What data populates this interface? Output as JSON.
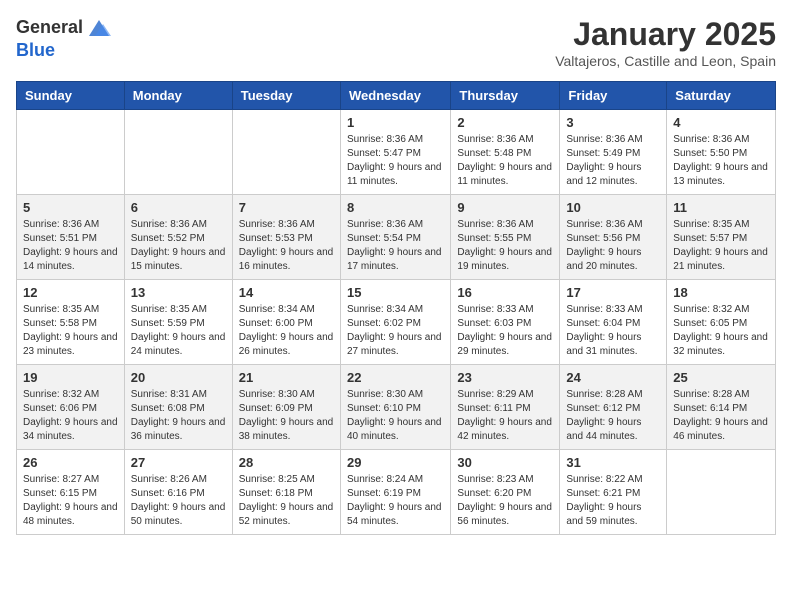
{
  "logo": {
    "general": "General",
    "blue": "Blue"
  },
  "title": "January 2025",
  "subtitle": "Valtajeros, Castille and Leon, Spain",
  "weekdays": [
    "Sunday",
    "Monday",
    "Tuesday",
    "Wednesday",
    "Thursday",
    "Friday",
    "Saturday"
  ],
  "weeks": [
    [
      {
        "day": "",
        "info": ""
      },
      {
        "day": "",
        "info": ""
      },
      {
        "day": "",
        "info": ""
      },
      {
        "day": "1",
        "info": "Sunrise: 8:36 AM\nSunset: 5:47 PM\nDaylight: 9 hours and 11 minutes."
      },
      {
        "day": "2",
        "info": "Sunrise: 8:36 AM\nSunset: 5:48 PM\nDaylight: 9 hours and 11 minutes."
      },
      {
        "day": "3",
        "info": "Sunrise: 8:36 AM\nSunset: 5:49 PM\nDaylight: 9 hours and 12 minutes."
      },
      {
        "day": "4",
        "info": "Sunrise: 8:36 AM\nSunset: 5:50 PM\nDaylight: 9 hours and 13 minutes."
      }
    ],
    [
      {
        "day": "5",
        "info": "Sunrise: 8:36 AM\nSunset: 5:51 PM\nDaylight: 9 hours and 14 minutes."
      },
      {
        "day": "6",
        "info": "Sunrise: 8:36 AM\nSunset: 5:52 PM\nDaylight: 9 hours and 15 minutes."
      },
      {
        "day": "7",
        "info": "Sunrise: 8:36 AM\nSunset: 5:53 PM\nDaylight: 9 hours and 16 minutes."
      },
      {
        "day": "8",
        "info": "Sunrise: 8:36 AM\nSunset: 5:54 PM\nDaylight: 9 hours and 17 minutes."
      },
      {
        "day": "9",
        "info": "Sunrise: 8:36 AM\nSunset: 5:55 PM\nDaylight: 9 hours and 19 minutes."
      },
      {
        "day": "10",
        "info": "Sunrise: 8:36 AM\nSunset: 5:56 PM\nDaylight: 9 hours and 20 minutes."
      },
      {
        "day": "11",
        "info": "Sunrise: 8:35 AM\nSunset: 5:57 PM\nDaylight: 9 hours and 21 minutes."
      }
    ],
    [
      {
        "day": "12",
        "info": "Sunrise: 8:35 AM\nSunset: 5:58 PM\nDaylight: 9 hours and 23 minutes."
      },
      {
        "day": "13",
        "info": "Sunrise: 8:35 AM\nSunset: 5:59 PM\nDaylight: 9 hours and 24 minutes."
      },
      {
        "day": "14",
        "info": "Sunrise: 8:34 AM\nSunset: 6:00 PM\nDaylight: 9 hours and 26 minutes."
      },
      {
        "day": "15",
        "info": "Sunrise: 8:34 AM\nSunset: 6:02 PM\nDaylight: 9 hours and 27 minutes."
      },
      {
        "day": "16",
        "info": "Sunrise: 8:33 AM\nSunset: 6:03 PM\nDaylight: 9 hours and 29 minutes."
      },
      {
        "day": "17",
        "info": "Sunrise: 8:33 AM\nSunset: 6:04 PM\nDaylight: 9 hours and 31 minutes."
      },
      {
        "day": "18",
        "info": "Sunrise: 8:32 AM\nSunset: 6:05 PM\nDaylight: 9 hours and 32 minutes."
      }
    ],
    [
      {
        "day": "19",
        "info": "Sunrise: 8:32 AM\nSunset: 6:06 PM\nDaylight: 9 hours and 34 minutes."
      },
      {
        "day": "20",
        "info": "Sunrise: 8:31 AM\nSunset: 6:08 PM\nDaylight: 9 hours and 36 minutes."
      },
      {
        "day": "21",
        "info": "Sunrise: 8:30 AM\nSunset: 6:09 PM\nDaylight: 9 hours and 38 minutes."
      },
      {
        "day": "22",
        "info": "Sunrise: 8:30 AM\nSunset: 6:10 PM\nDaylight: 9 hours and 40 minutes."
      },
      {
        "day": "23",
        "info": "Sunrise: 8:29 AM\nSunset: 6:11 PM\nDaylight: 9 hours and 42 minutes."
      },
      {
        "day": "24",
        "info": "Sunrise: 8:28 AM\nSunset: 6:12 PM\nDaylight: 9 hours and 44 minutes."
      },
      {
        "day": "25",
        "info": "Sunrise: 8:28 AM\nSunset: 6:14 PM\nDaylight: 9 hours and 46 minutes."
      }
    ],
    [
      {
        "day": "26",
        "info": "Sunrise: 8:27 AM\nSunset: 6:15 PM\nDaylight: 9 hours and 48 minutes."
      },
      {
        "day": "27",
        "info": "Sunrise: 8:26 AM\nSunset: 6:16 PM\nDaylight: 9 hours and 50 minutes."
      },
      {
        "day": "28",
        "info": "Sunrise: 8:25 AM\nSunset: 6:18 PM\nDaylight: 9 hours and 52 minutes."
      },
      {
        "day": "29",
        "info": "Sunrise: 8:24 AM\nSunset: 6:19 PM\nDaylight: 9 hours and 54 minutes."
      },
      {
        "day": "30",
        "info": "Sunrise: 8:23 AM\nSunset: 6:20 PM\nDaylight: 9 hours and 56 minutes."
      },
      {
        "day": "31",
        "info": "Sunrise: 8:22 AM\nSunset: 6:21 PM\nDaylight: 9 hours and 59 minutes."
      },
      {
        "day": "",
        "info": ""
      }
    ]
  ]
}
